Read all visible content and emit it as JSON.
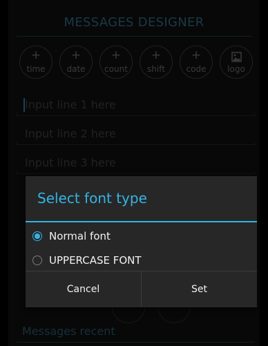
{
  "app": {
    "title": "MESSAGES DESIGNER"
  },
  "insert_buttons": [
    {
      "symbol": "+",
      "label": "time"
    },
    {
      "symbol": "+",
      "label": "date"
    },
    {
      "symbol": "+",
      "label": "count"
    },
    {
      "symbol": "+",
      "label": "shift"
    },
    {
      "symbol": "+",
      "label": "code"
    },
    {
      "symbol": "image-icon",
      "label": "logo"
    }
  ],
  "inputs": [
    {
      "placeholder": "Input line 1 here",
      "focused": true
    },
    {
      "placeholder": "Input line 2 here"
    },
    {
      "placeholder": "Input line 3 here"
    }
  ],
  "recent": {
    "label": "Messages recent"
  },
  "dialog": {
    "title": "Select font type",
    "options": [
      {
        "label": "Normal font",
        "checked": true
      },
      {
        "label": "UPPERCASE FONT",
        "checked": false
      }
    ],
    "cancel_label": "Cancel",
    "set_label": "Set"
  },
  "colors": {
    "accent": "#33b5e5",
    "title_dim": "#2e6780",
    "dialog_bg": "#272727",
    "background": "#101010"
  }
}
